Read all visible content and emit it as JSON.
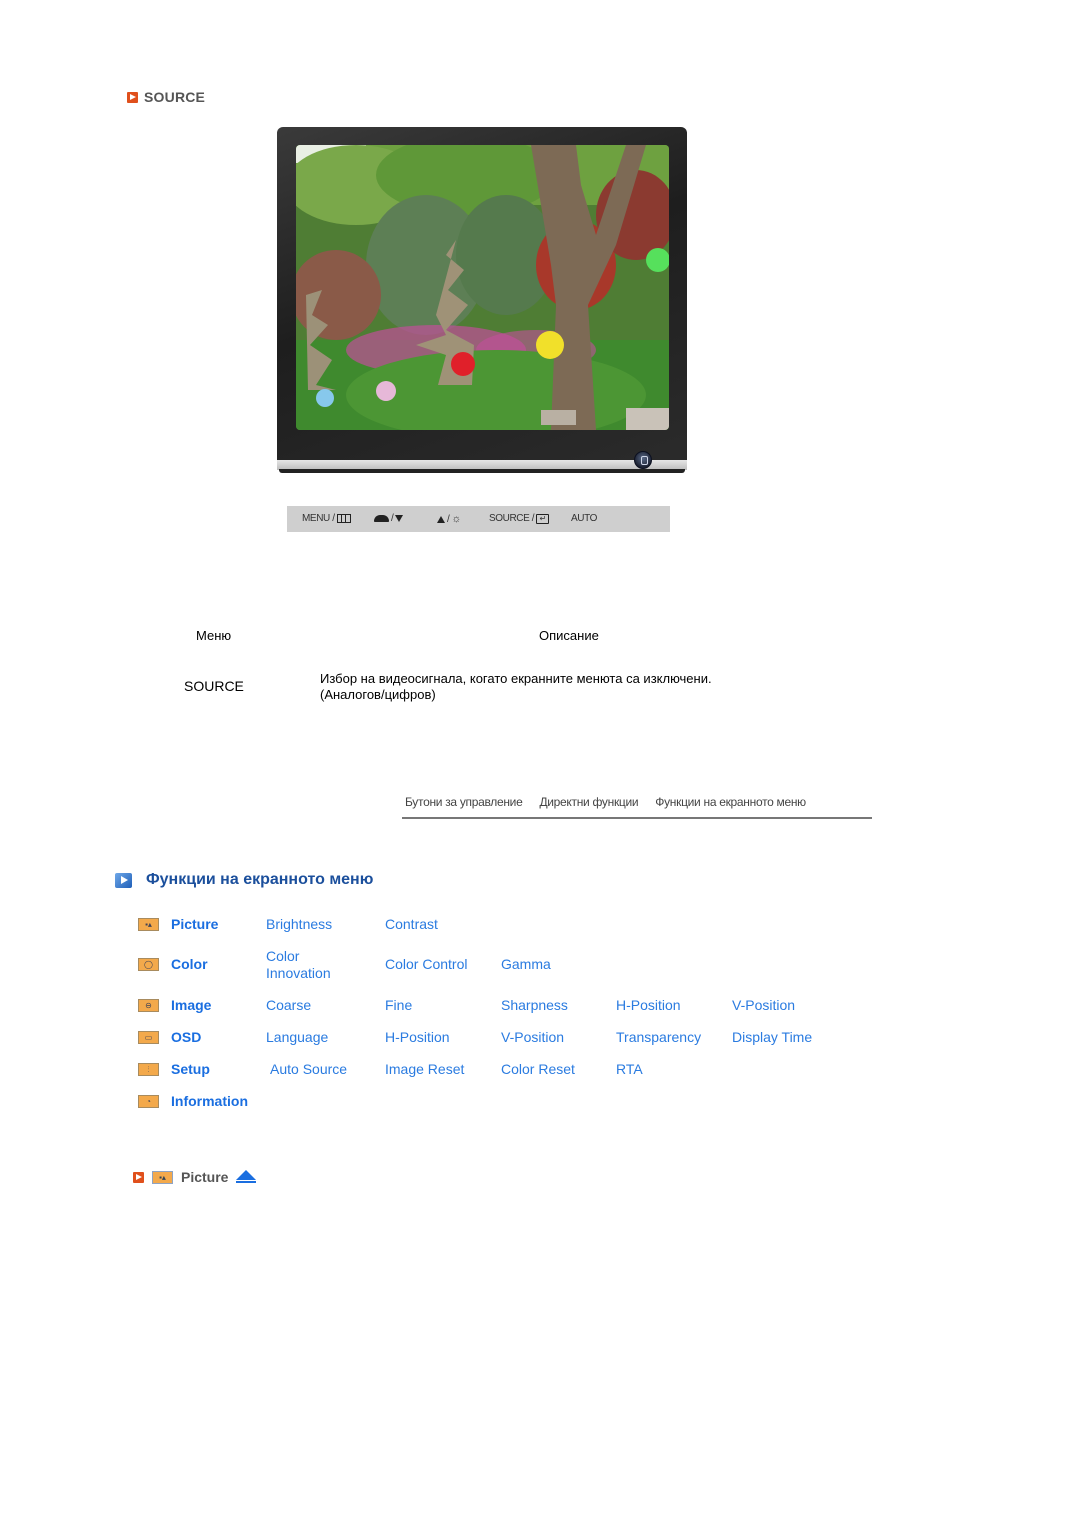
{
  "section": {
    "icon": "orange-play-icon",
    "title": "SOURCE"
  },
  "monitor": {
    "image_description": "Garden with stone pagodas, tree and paper lanterns",
    "power_icon": "power-button-icon"
  },
  "control_bar": {
    "menu_label": "MENU /",
    "menu_icon": "grid-icon",
    "brightness_icon": "eye-icon",
    "down_icon": "triangle-down-icon",
    "up_label": "/",
    "up_icon": "triangle-up-icon",
    "sun_icon": "☼",
    "source_label": "SOURCE /",
    "enter_icon": "↵",
    "auto_label": "AUTO"
  },
  "table": {
    "headers": [
      "Меню",
      "Описание"
    ],
    "rows": [
      {
        "menu": "SOURCE",
        "description_line1": "Избор на видеосигнала, когато екранните менюта са изключени.",
        "description_line2": "(Аналогов/цифров)"
      }
    ]
  },
  "nav_tabs": [
    "Бутони за управление",
    "Директни функции",
    "Функции на екранното меню"
  ],
  "osd": {
    "icon": "blue-play-icon",
    "title": "Функции на екранното меню",
    "rows": [
      {
        "category": "Picture",
        "icon_glyph": "▪▴",
        "items": [
          "Brightness",
          "Contrast"
        ]
      },
      {
        "category": "Color",
        "icon_glyph": "◯",
        "items": [
          "Color Innovation",
          "Color Control",
          "Gamma"
        ]
      },
      {
        "category": "Image",
        "icon_glyph": "⊖",
        "items": [
          "Coarse",
          "Fine",
          "Sharpness",
          "H-Position",
          "V-Position"
        ]
      },
      {
        "category": "OSD",
        "icon_glyph": "▭",
        "items": [
          "Language",
          "H-Position",
          "V-Position",
          "Transparency",
          "Display Time"
        ]
      },
      {
        "category": "Setup",
        "icon_glyph": "⫶",
        "items": [
          "Auto Source",
          "Image Reset",
          "Color Reset",
          "RTA"
        ]
      },
      {
        "category": "Information",
        "icon_glyph": "◔",
        "items": []
      }
    ],
    "color_innovation_line1": "Color",
    "color_innovation_line2": "Innovation"
  },
  "bottom_link": {
    "label": "Picture",
    "icon_glyph": "▪▴"
  },
  "colors": {
    "link_blue": "#2a7be0",
    "category_blue": "#1a6ee0",
    "heading_blue": "#1b4f9c",
    "accent_orange": "#e0501c",
    "icon_orange": "#f3a94b"
  }
}
